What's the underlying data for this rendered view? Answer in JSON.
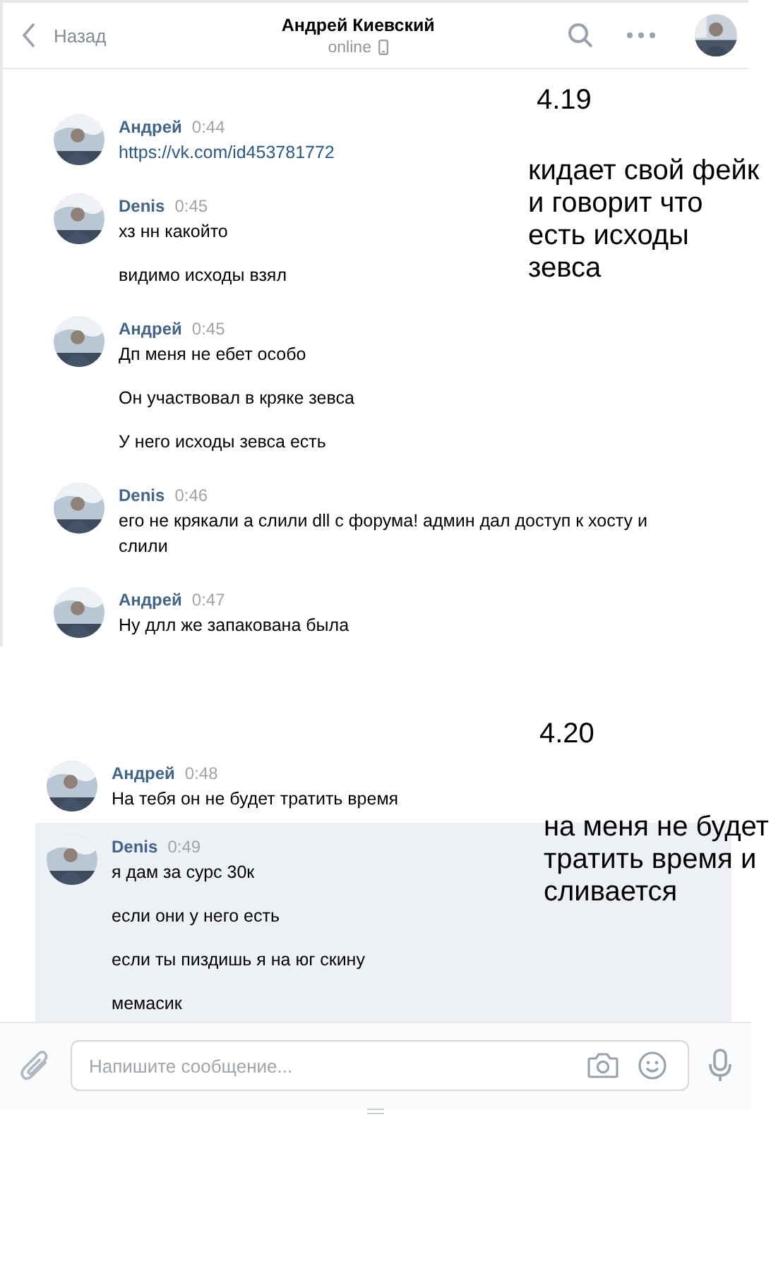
{
  "header": {
    "back": "Назад",
    "title": "Андрей Киевский",
    "status": "online"
  },
  "sections": [
    {
      "label": "4.19",
      "note": "кидает свой фейк и говорит что есть исходы зевса",
      "messages": [
        {
          "author": "Андрей",
          "time": "0:44",
          "selected": false,
          "lines": [
            {
              "kind": "link",
              "text": "https://vk.com/id453781772"
            }
          ]
        },
        {
          "author": "Denis",
          "time": "0:45",
          "selected": false,
          "lines": [
            {
              "kind": "text",
              "text": "хз нн какойто"
            },
            {
              "kind": "text",
              "text": "видимо исходы взял"
            }
          ]
        },
        {
          "author": "Андрей",
          "time": "0:45",
          "selected": false,
          "lines": [
            {
              "kind": "text",
              "text": "Дп меня не ебет особо"
            },
            {
              "kind": "text",
              "text": "Он участвовал в кряке зевса"
            },
            {
              "kind": "text",
              "text": "У него исходы зевса есть"
            }
          ]
        },
        {
          "author": "Denis",
          "time": "0:46",
          "selected": false,
          "lines": [
            {
              "kind": "text",
              "text": "его не крякали а слили dll с форума! админ дал доступ к хосту и слили"
            }
          ]
        },
        {
          "author": "Андрей",
          "time": "0:47",
          "selected": false,
          "lines": [
            {
              "kind": "text",
              "text": "Ну длл же запакована была"
            }
          ]
        }
      ]
    },
    {
      "label": "4.20",
      "note": "на меня не будет тратить время и сливается",
      "messages": [
        {
          "author": "Андрей",
          "time": "0:48",
          "selected": false,
          "lines": [
            {
              "kind": "text",
              "text": "На тебя он не будет тратить время"
            }
          ]
        },
        {
          "author": "Denis",
          "time": "0:49",
          "selected": true,
          "lines": [
            {
              "kind": "text",
              "text": "я дам за сурс 30к"
            },
            {
              "kind": "text",
              "text": "если они у него есть"
            },
            {
              "kind": "text",
              "text": "если ты пиздишь я на юг скину"
            },
            {
              "kind": "text",
              "text": "мемасик"
            }
          ]
        }
      ]
    }
  ],
  "composer": {
    "placeholder": "Напишите сообщение..."
  }
}
